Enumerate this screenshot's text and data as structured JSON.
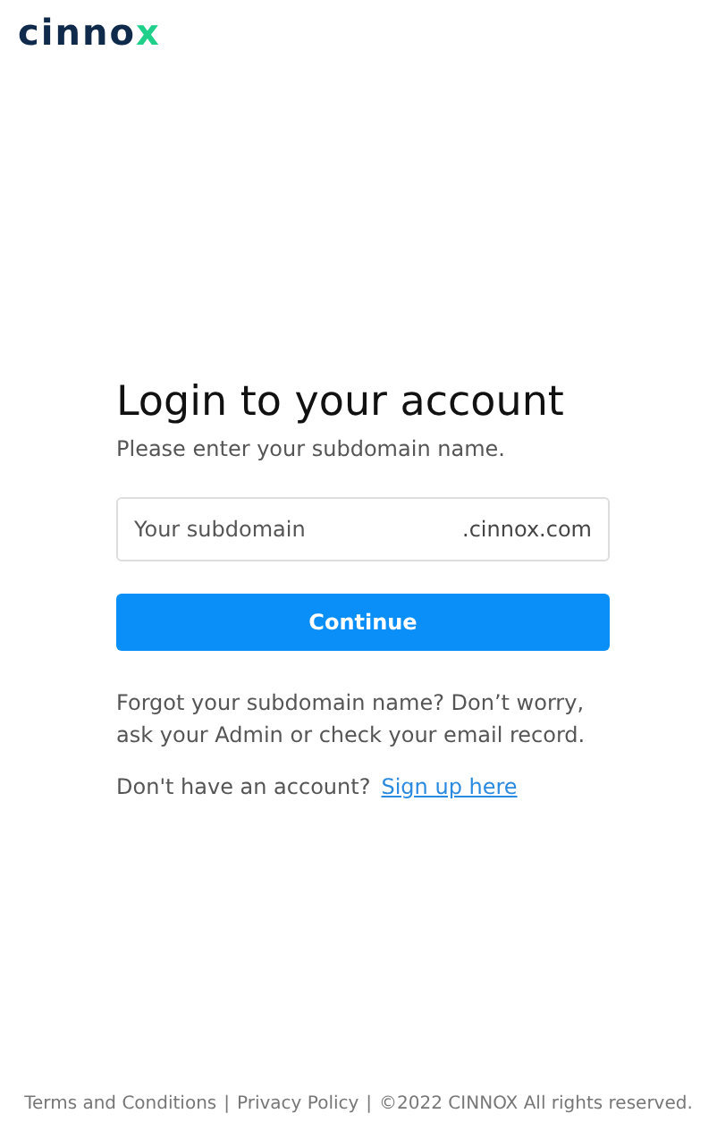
{
  "logo": {
    "text": "cinno",
    "accent": "x"
  },
  "heading": "Login to your account",
  "subtitle": "Please enter your subdomain name.",
  "subdomain_field": {
    "placeholder": "Your subdomain",
    "suffix": ".cinnox.com"
  },
  "continue_button": "Continue",
  "help_text": "Forgot your subdomain name? Don’t worry, ask your Admin or check your email record.",
  "signup": {
    "prompt": "Don't have an account?",
    "link": "Sign up here"
  },
  "footer": {
    "links": [
      "Terms and Conditions",
      "Privacy Policy"
    ],
    "separator": "|",
    "copyright": "©2022 CINNOX All rights reserved."
  }
}
